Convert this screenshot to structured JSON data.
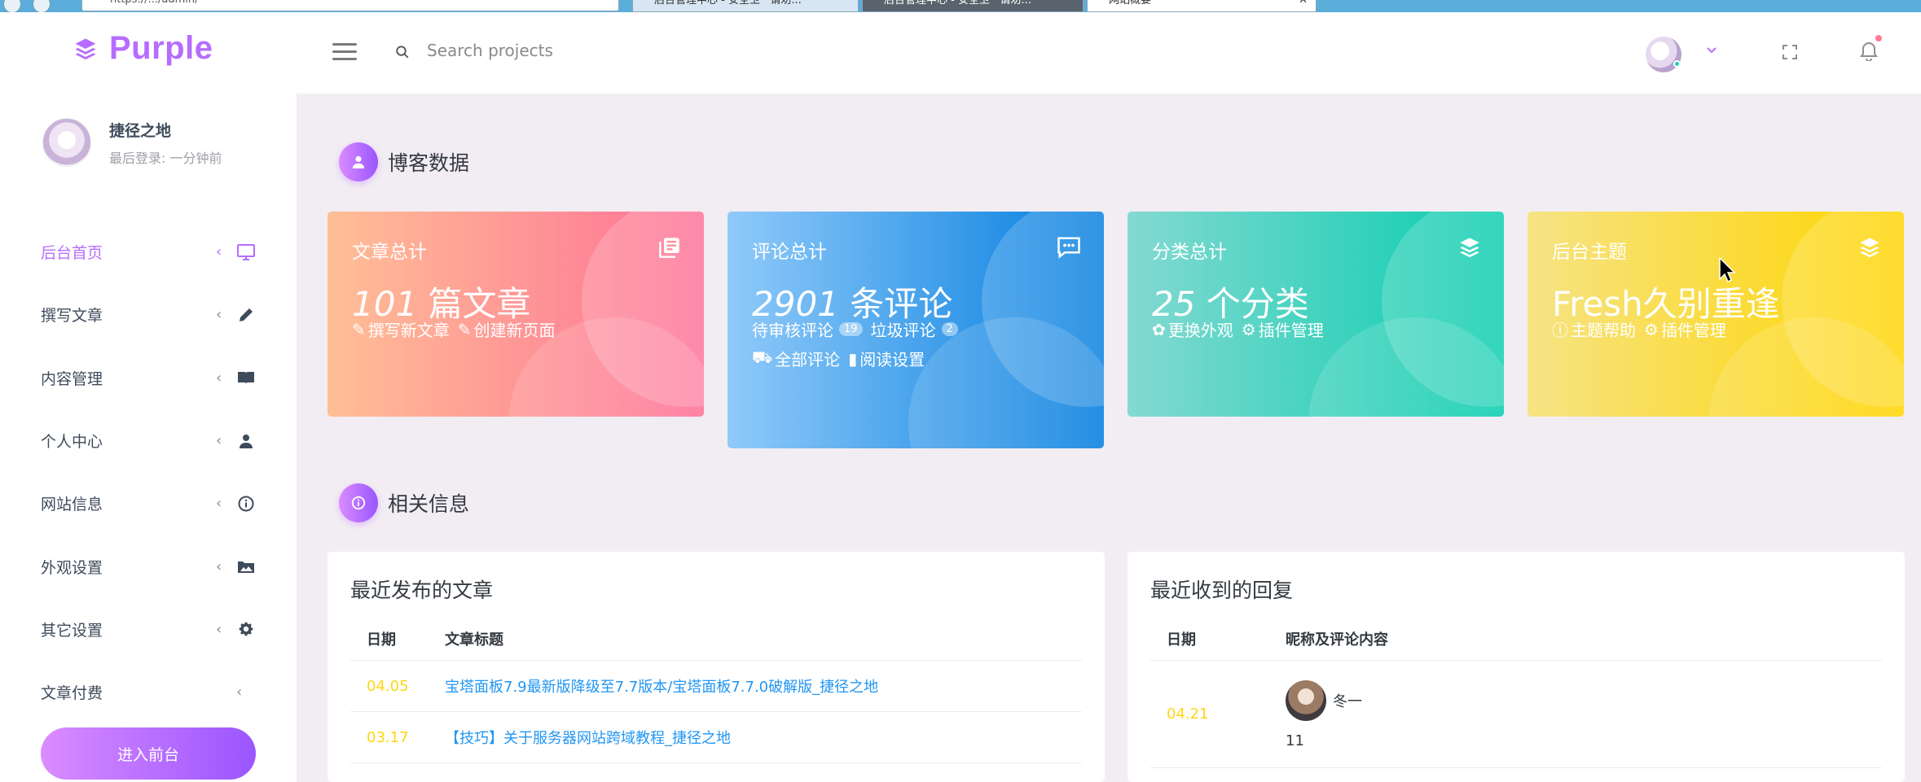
{
  "browser": {
    "address": "https://.../admin/",
    "tabs": [
      {
        "label": "后台管理中心 - 安全卫 · 请劝..."
      },
      {
        "label": "后台管理中心 - 安全卫 · 请劝..."
      },
      {
        "label": "网站概要"
      }
    ]
  },
  "navbar": {
    "brand": "Purple",
    "search_placeholder": "Search projects"
  },
  "profile": {
    "name": "捷径之地",
    "last_login": "最后登录: 一分钟前"
  },
  "sidebar": {
    "items": [
      {
        "label": "后台首页",
        "icon": "monitor-icon"
      },
      {
        "label": "撰写文章",
        "icon": "pencil-icon"
      },
      {
        "label": "内容管理",
        "icon": "book-icon"
      },
      {
        "label": "个人中心",
        "icon": "user-icon"
      },
      {
        "label": "网站信息",
        "icon": "info-icon"
      },
      {
        "label": "外观设置",
        "icon": "image-icon"
      },
      {
        "label": "其它设置",
        "icon": "gear-icon"
      },
      {
        "label": "文章付费",
        "icon": ""
      }
    ],
    "front_button": "进入前台"
  },
  "sections": {
    "blog_data": "博客数据",
    "related_info": "相关信息"
  },
  "cards": {
    "posts": {
      "label": "文章总计",
      "number": "101",
      "unit": " 篇文章",
      "link1": "撰写新文章",
      "link2": "创建新页面"
    },
    "comments": {
      "label": "评论总计",
      "number": "2901",
      "unit": " 条评论",
      "link1": "待审核评论",
      "badge1": "19",
      "link2": "垃圾评论",
      "badge2": "2",
      "link3": "全部评论",
      "link4": "阅读设置"
    },
    "categories": {
      "label": "分类总计",
      "number": "25",
      "unit": " 个分类",
      "link1": "更换外观",
      "link2": "插件管理"
    },
    "theme": {
      "label": "后台主题",
      "value": "Fresh久别重逢",
      "link1": "主题帮助",
      "link2": "插件管理"
    }
  },
  "recent_posts": {
    "title": "最近发布的文章",
    "col_date": "日期",
    "col_title": "文章标题",
    "rows": [
      {
        "date": "04.05",
        "title": "宝塔面板7.9最新版降级至7.7版本/宝塔面板7.7.0破解版_捷径之地"
      },
      {
        "date": "03.17",
        "title": "【技巧】关于服务器网站跨域教程_捷径之地"
      }
    ]
  },
  "recent_replies": {
    "title": "最近收到的回复",
    "col_date": "日期",
    "col_content": "昵称及评论内容",
    "rows": [
      {
        "date": "04.21",
        "name": "冬一",
        "content": "11"
      }
    ]
  },
  "colors": {
    "accent": "#b66dff",
    "date": "#fed713",
    "link": "#2196f3"
  }
}
